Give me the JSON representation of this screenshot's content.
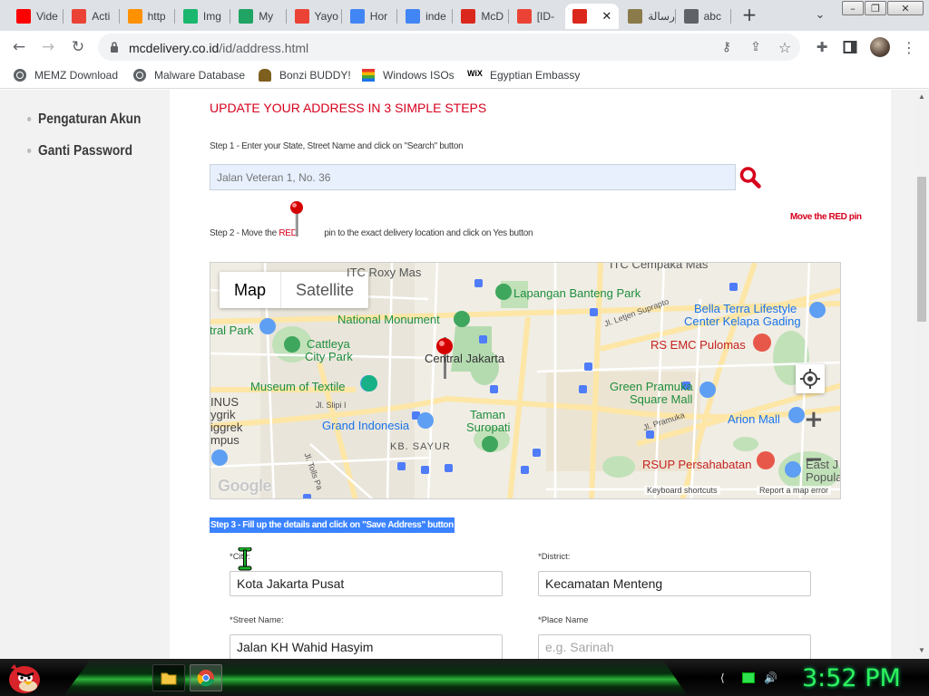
{
  "tabs": [
    {
      "label": "Vide",
      "icon": "youtube-icon",
      "color": "#ff0000"
    },
    {
      "label": "Acti",
      "icon": "gmail-icon",
      "color": "#ea4335"
    },
    {
      "label": "http",
      "icon": "ph-icon",
      "color": "#ff9000"
    },
    {
      "label": "Img",
      "icon": "imgur-icon",
      "color": "#1bb76e"
    },
    {
      "label": "My",
      "icon": "drive-icon",
      "color": "#1fa463"
    },
    {
      "label": "Yayo",
      "icon": "maps-pin-icon",
      "color": "#ea4335"
    },
    {
      "label": "Hor",
      "icon": "google-icon",
      "color": "#4285f4"
    },
    {
      "label": "inde",
      "icon": "google-icon",
      "color": "#4285f4"
    },
    {
      "label": "McD",
      "icon": "mcdonalds-icon",
      "color": "#da291c"
    },
    {
      "label": "[ID-",
      "icon": "gmail-icon",
      "color": "#ea4335"
    },
    {
      "label": "",
      "icon": "mcdonalds-icon",
      "color": "#da291c",
      "active": true
    },
    {
      "label": "رسالة",
      "icon": "seal-icon",
      "color": "#8b7b4a"
    },
    {
      "label": "abc",
      "icon": "globe-icon",
      "color": "#5f6368"
    }
  ],
  "toolbar": {
    "url_host": "mcdelivery.co.id",
    "url_path": "/id/address.html"
  },
  "bookmarks": [
    {
      "label": "MEMZ Download",
      "icon": "globe-icon"
    },
    {
      "label": "Malware Database",
      "icon": "globe-icon"
    },
    {
      "label": "Bonzi BUDDY!",
      "icon": "bonzi-icon"
    },
    {
      "label": "Windows ISOs",
      "icon": "windows-flag-icon"
    },
    {
      "label": "Egyptian Embassy",
      "icon": "wix-icon"
    }
  ],
  "sidebar": {
    "items": [
      "Pengaturan Akun",
      "Ganti Password"
    ]
  },
  "page": {
    "title": "UPDATE YOUR ADDRESS IN 3 SIMPLE STEPS",
    "step1": "Step 1 - Enter your State, Street Name and click on \"Search\" button",
    "search_placeholder": "Jalan Veteran 1, No. 36",
    "step2_pre": "Step 2 - Move the",
    "step2_red": "RED",
    "step2_post": "pin to the exact delivery location and click on Yes button",
    "move_red_pin": "Move the RED pin",
    "step3": "Step 3 - Fill up the details and click on \"Save Address\" button"
  },
  "map": {
    "type_map": "Map",
    "type_satellite": "Satellite",
    "labels": [
      "ITC Roxy Mas",
      "ITC Cempaka Mas",
      "Lapangan Banteng Park",
      "National Monument",
      "Bella Terra Lifestyle",
      "Center Kelapa Gading",
      "tral Park",
      "Cattleya",
      "City Park",
      "Jl. Letjen Suprapto",
      "RS EMC Pulomas",
      "Central Jakarta",
      "Museum of Textile",
      "Green Pramuka",
      "Square Mall",
      "INUS",
      "ygrik",
      "iggrek",
      "mpus",
      "Jl. Slipi I",
      "Grand Indonesia",
      "Taman",
      "Suropati",
      "Arion Mall",
      "Jl. Pramuka",
      "KB. SAYUR",
      "Jl. Tolls Pa",
      "RSUP Persahabatan",
      "East J",
      "Popula"
    ],
    "google": "Google",
    "keyboard_shortcuts": "Keyboard shortcuts",
    "report": "Report a map error"
  },
  "form": {
    "city_label": "*City:",
    "city_value": "Kota Jakarta Pusat",
    "district_label": "*District:",
    "district_value": "Kecamatan Menteng",
    "street_label": "*Street Name:",
    "street_value": "Jalan KH Wahid Hasyim",
    "place_label": "*Place Name",
    "place_placeholder": "e.g. Sarinah"
  },
  "taskbar": {
    "clock": "3:52 PM"
  }
}
